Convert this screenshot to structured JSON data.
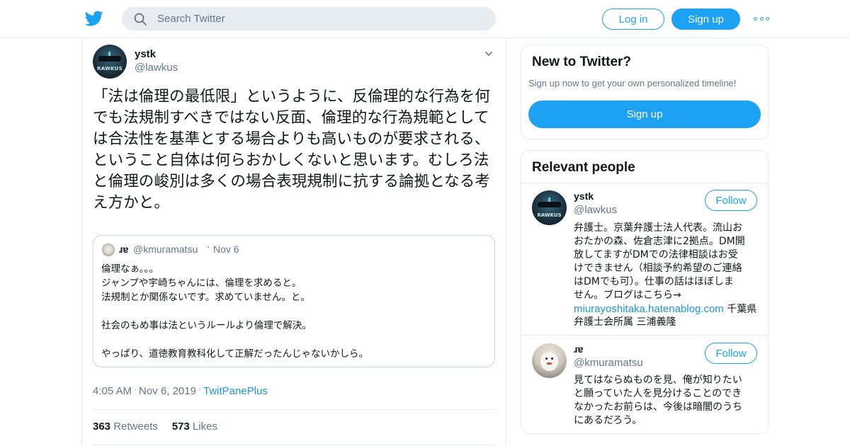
{
  "header": {
    "search_placeholder": "Search Twitter",
    "login_label": "Log in",
    "signup_label": "Sign up"
  },
  "tweet": {
    "author_name": "ystk",
    "author_handle": "@lawkus",
    "avatar_text": "RAWKUS",
    "text": "「法は倫理の最低限」というように、反倫理的な行為を何でも法規制すべきではない反面、倫理的な行為規範としては合法性を基準とする場合よりも高いものが要求される、ということ自体は何らおかしくないと思います。むしろ法と倫理の峻別は多くの場合表現規制に抗する論拠となる考え方かと。",
    "quoted": {
      "name": "ɹɐ",
      "handle": "@kmuramatsu",
      "date": "Nov 6",
      "lines": [
        "倫理なぁ。。。",
        "ジャンプや宇崎ちゃんには、倫理を求めると。",
        "法規制とか関係ないです。求めていません。と。",
        "",
        "社会のもめ事は法というルールより倫理で解決。",
        "",
        "やっぱり、道徳教育教科化して正解だったんじゃないかしら。"
      ]
    },
    "time": "4:05 AM",
    "date": "Nov 6, 2019",
    "source": "TwitPanePlus",
    "retweets_count": "363",
    "retweets_label": "Retweets",
    "likes_count": "573",
    "likes_label": "Likes"
  },
  "sidebar": {
    "new_card": {
      "title": "New to Twitter?",
      "subtitle": "Sign up now to get your own personalized timeline!",
      "button": "Sign up"
    },
    "relevant": {
      "title": "Relevant people",
      "people": [
        {
          "name": "ystk",
          "handle": "@lawkus",
          "follow": "Follow",
          "avatar_text": "RAWKUS",
          "bio_lines": [
            "弁護士。京葉弁護士法人代表。流山お",
            "おたかの森、佐倉志津に2拠点。DM開",
            "放してますがDMでの法律相談はお受",
            "けできません（相談予約希望のご連絡",
            "はDMでも可）。仕事の話はほぼしま",
            "せん。ブログはこちら→"
          ],
          "bio_link": "miurayoshitaka.hatenablog.com",
          "bio_after_link": " 千葉県",
          "bio_last": "弁護士会所属 三浦義隆"
        },
        {
          "name": "ɹɐ",
          "handle": "@kmuramatsu",
          "follow": "Follow",
          "bio_lines": [
            "見てはならぬものを見、俺が知りたい",
            "と願っていた人を見分けることのでき",
            "なかったお前らは、今後は暗闇のうち",
            "にあるだろう。"
          ]
        }
      ]
    }
  },
  "colors": {
    "brand": "#1da1f2",
    "link": "#1b95e0",
    "muted": "#657786",
    "border": "#e6ecf0"
  },
  "icons": [
    "twitter-bird-icon",
    "search-icon",
    "more-dots-icon",
    "chevron-down-icon"
  ]
}
